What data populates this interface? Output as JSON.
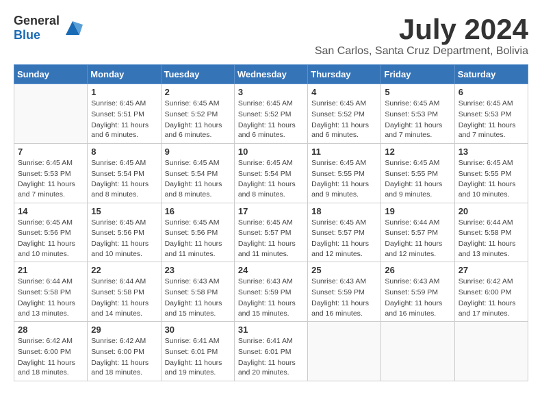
{
  "header": {
    "logo_general": "General",
    "logo_blue": "Blue",
    "month_title": "July 2024",
    "location": "San Carlos, Santa Cruz Department, Bolivia"
  },
  "weekdays": [
    "Sunday",
    "Monday",
    "Tuesday",
    "Wednesday",
    "Thursday",
    "Friday",
    "Saturday"
  ],
  "weeks": [
    [
      {
        "day": "",
        "empty": true
      },
      {
        "day": "1",
        "sunrise": "6:45 AM",
        "sunset": "5:51 PM",
        "daylight": "11 hours and 6 minutes."
      },
      {
        "day": "2",
        "sunrise": "6:45 AM",
        "sunset": "5:52 PM",
        "daylight": "11 hours and 6 minutes."
      },
      {
        "day": "3",
        "sunrise": "6:45 AM",
        "sunset": "5:52 PM",
        "daylight": "11 hours and 6 minutes."
      },
      {
        "day": "4",
        "sunrise": "6:45 AM",
        "sunset": "5:52 PM",
        "daylight": "11 hours and 6 minutes."
      },
      {
        "day": "5",
        "sunrise": "6:45 AM",
        "sunset": "5:53 PM",
        "daylight": "11 hours and 7 minutes."
      },
      {
        "day": "6",
        "sunrise": "6:45 AM",
        "sunset": "5:53 PM",
        "daylight": "11 hours and 7 minutes."
      }
    ],
    [
      {
        "day": "7",
        "sunrise": "6:45 AM",
        "sunset": "5:53 PM",
        "daylight": "11 hours and 7 minutes."
      },
      {
        "day": "8",
        "sunrise": "6:45 AM",
        "sunset": "5:54 PM",
        "daylight": "11 hours and 8 minutes."
      },
      {
        "day": "9",
        "sunrise": "6:45 AM",
        "sunset": "5:54 PM",
        "daylight": "11 hours and 8 minutes."
      },
      {
        "day": "10",
        "sunrise": "6:45 AM",
        "sunset": "5:54 PM",
        "daylight": "11 hours and 8 minutes."
      },
      {
        "day": "11",
        "sunrise": "6:45 AM",
        "sunset": "5:55 PM",
        "daylight": "11 hours and 9 minutes."
      },
      {
        "day": "12",
        "sunrise": "6:45 AM",
        "sunset": "5:55 PM",
        "daylight": "11 hours and 9 minutes."
      },
      {
        "day": "13",
        "sunrise": "6:45 AM",
        "sunset": "5:55 PM",
        "daylight": "11 hours and 10 minutes."
      }
    ],
    [
      {
        "day": "14",
        "sunrise": "6:45 AM",
        "sunset": "5:56 PM",
        "daylight": "11 hours and 10 minutes."
      },
      {
        "day": "15",
        "sunrise": "6:45 AM",
        "sunset": "5:56 PM",
        "daylight": "11 hours and 10 minutes."
      },
      {
        "day": "16",
        "sunrise": "6:45 AM",
        "sunset": "5:56 PM",
        "daylight": "11 hours and 11 minutes."
      },
      {
        "day": "17",
        "sunrise": "6:45 AM",
        "sunset": "5:57 PM",
        "daylight": "11 hours and 11 minutes."
      },
      {
        "day": "18",
        "sunrise": "6:45 AM",
        "sunset": "5:57 PM",
        "daylight": "11 hours and 12 minutes."
      },
      {
        "day": "19",
        "sunrise": "6:44 AM",
        "sunset": "5:57 PM",
        "daylight": "11 hours and 12 minutes."
      },
      {
        "day": "20",
        "sunrise": "6:44 AM",
        "sunset": "5:58 PM",
        "daylight": "11 hours and 13 minutes."
      }
    ],
    [
      {
        "day": "21",
        "sunrise": "6:44 AM",
        "sunset": "5:58 PM",
        "daylight": "11 hours and 13 minutes."
      },
      {
        "day": "22",
        "sunrise": "6:44 AM",
        "sunset": "5:58 PM",
        "daylight": "11 hours and 14 minutes."
      },
      {
        "day": "23",
        "sunrise": "6:43 AM",
        "sunset": "5:58 PM",
        "daylight": "11 hours and 15 minutes."
      },
      {
        "day": "24",
        "sunrise": "6:43 AM",
        "sunset": "5:59 PM",
        "daylight": "11 hours and 15 minutes."
      },
      {
        "day": "25",
        "sunrise": "6:43 AM",
        "sunset": "5:59 PM",
        "daylight": "11 hours and 16 minutes."
      },
      {
        "day": "26",
        "sunrise": "6:43 AM",
        "sunset": "5:59 PM",
        "daylight": "11 hours and 16 minutes."
      },
      {
        "day": "27",
        "sunrise": "6:42 AM",
        "sunset": "6:00 PM",
        "daylight": "11 hours and 17 minutes."
      }
    ],
    [
      {
        "day": "28",
        "sunrise": "6:42 AM",
        "sunset": "6:00 PM",
        "daylight": "11 hours and 18 minutes."
      },
      {
        "day": "29",
        "sunrise": "6:42 AM",
        "sunset": "6:00 PM",
        "daylight": "11 hours and 18 minutes."
      },
      {
        "day": "30",
        "sunrise": "6:41 AM",
        "sunset": "6:01 PM",
        "daylight": "11 hours and 19 minutes."
      },
      {
        "day": "31",
        "sunrise": "6:41 AM",
        "sunset": "6:01 PM",
        "daylight": "11 hours and 20 minutes."
      },
      {
        "day": "",
        "empty": true
      },
      {
        "day": "",
        "empty": true
      },
      {
        "day": "",
        "empty": true
      }
    ]
  ]
}
